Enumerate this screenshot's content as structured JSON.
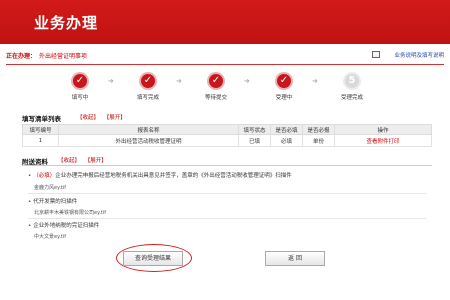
{
  "header": {
    "title": "业务办理"
  },
  "status": {
    "label": "正在办理：",
    "value": "外出经营证明事项",
    "help_link": "业务说明及填写说明"
  },
  "steps": [
    {
      "label": "填写中",
      "icon": "check-icon",
      "done": true
    },
    {
      "label": "填写完成",
      "icon": "check-icon",
      "done": true
    },
    {
      "label": "等待提交",
      "icon": "check-icon",
      "done": true
    },
    {
      "label": "受理中",
      "icon": "check-icon",
      "done": true
    },
    {
      "label": "受理完成",
      "number": "5",
      "done": false
    }
  ],
  "fill_list": {
    "title": "填写清单列表",
    "collapse_label": "【收起】",
    "expand_label": "【展开】",
    "columns": [
      "填写编号",
      "报表名称",
      "填写状态",
      "是否必填",
      "是否必报",
      "操作"
    ],
    "rows": [
      {
        "no": "1",
        "name": "外出经营活动税收管理证明",
        "state": "已填",
        "required": "必填",
        "must_report": "单份",
        "action": "查看附件打印"
      }
    ]
  },
  "attachments": {
    "title": "附送资料",
    "collapse_label": "【收起】",
    "expand_label": "【展开】",
    "items": [
      {
        "required_tag": "（必填）",
        "text": "企业办理完申报后经营地税务机关出具意见并签字，盖章的《外出经营活动税收管理证明》扫描件",
        "file": "金鹿力风ey.tif"
      },
      {
        "required_tag": "",
        "text": "代开发票的扫描件",
        "file": "北京耕丰木美铁钢有限公司ey.tif"
      },
      {
        "required_tag": "",
        "text": "企业外地纳税的完证扫描件",
        "file": "中大文景ey.tif"
      }
    ]
  },
  "buttons": {
    "query": "查询受理结果",
    "back": "返 回"
  }
}
